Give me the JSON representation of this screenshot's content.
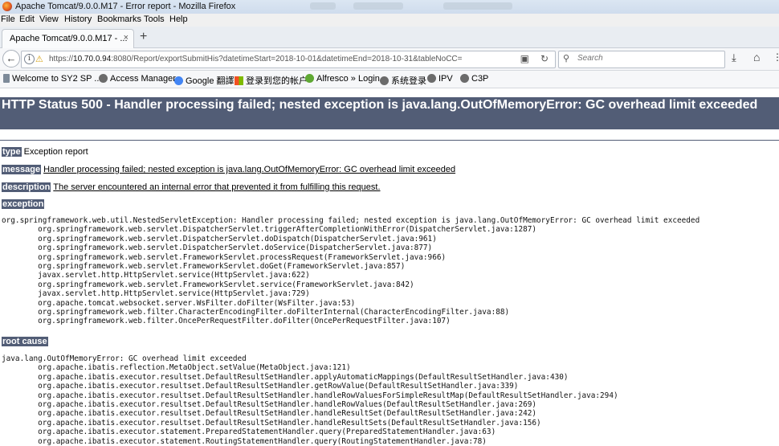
{
  "window": {
    "title": "Apache Tomcat/9.0.0.M17 - Error report - Mozilla Firefox"
  },
  "menu": [
    "File",
    "Edit",
    "View",
    "History",
    "Bookmarks",
    "Tools",
    "Help"
  ],
  "tab": {
    "label": "Apache Tomcat/9.0.0.M17 - ...",
    "close": "×"
  },
  "toolbar": {
    "url_prefix": "https://",
    "url_host": "10.70.0.94",
    "url_rest": ":8080/Report/exportSubmitHis?datetimeStart=2018-10-01&datetimeEnd=2018-10-31&tableNoCC=",
    "search_placeholder": "Search"
  },
  "bookmarks": [
    {
      "label": "Welcome to SY2 SP ...",
      "color": "#7d8a99"
    },
    {
      "label": "Access Manager",
      "color": "#6b6b6b"
    },
    {
      "label": "Google 翻譯",
      "color": "#4285f4"
    },
    {
      "label": "登录到您的帐户",
      "color": "#f25022"
    },
    {
      "label": "Alfresco » Login",
      "color": "#5fa833"
    },
    {
      "label": "系统登录",
      "color": "#6b6b6b"
    },
    {
      "label": "IPV",
      "color": "#6b6b6b"
    },
    {
      "label": "C3P",
      "color": "#6b6b6b"
    }
  ],
  "page": {
    "heading": "HTTP Status 500 - Handler processing failed; nested exception is java.lang.OutOfMemoryError: GC overhead limit exceeded",
    "type_label": "type",
    "type_value": "Exception report",
    "message_label": "message",
    "message_value": "Handler processing failed; nested exception is java.lang.OutOfMemoryError: GC overhead limit exceeded",
    "description_label": "description",
    "description_value": "The server encountered an internal error that prevented it from fulfilling this request.",
    "exception_label": "exception",
    "exception_trace": [
      "org.springframework.web.util.NestedServletException: Handler processing failed; nested exception is java.lang.OutOfMemoryError: GC overhead limit exceeded",
      "\torg.springframework.web.servlet.DispatcherServlet.triggerAfterCompletionWithError(DispatcherServlet.java:1287)",
      "\torg.springframework.web.servlet.DispatcherServlet.doDispatch(DispatcherServlet.java:961)",
      "\torg.springframework.web.servlet.DispatcherServlet.doService(DispatcherServlet.java:877)",
      "\torg.springframework.web.servlet.FrameworkServlet.processRequest(FrameworkServlet.java:966)",
      "\torg.springframework.web.servlet.FrameworkServlet.doGet(FrameworkServlet.java:857)",
      "\tjavax.servlet.http.HttpServlet.service(HttpServlet.java:622)",
      "\torg.springframework.web.servlet.FrameworkServlet.service(FrameworkServlet.java:842)",
      "\tjavax.servlet.http.HttpServlet.service(HttpServlet.java:729)",
      "\torg.apache.tomcat.websocket.server.WsFilter.doFilter(WsFilter.java:53)",
      "\torg.springframework.web.filter.CharacterEncodingFilter.doFilterInternal(CharacterEncodingFilter.java:88)",
      "\torg.springframework.web.filter.OncePerRequestFilter.doFilter(OncePerRequestFilter.java:107)"
    ],
    "root_cause_label": "root cause",
    "root_cause_trace": [
      "java.lang.OutOfMemoryError: GC overhead limit exceeded",
      "\torg.apache.ibatis.reflection.MetaObject.setValue(MetaObject.java:121)",
      "\torg.apache.ibatis.executor.resultset.DefaultResultSetHandler.applyAutomaticMappings(DefaultResultSetHandler.java:430)",
      "\torg.apache.ibatis.executor.resultset.DefaultResultSetHandler.getRowValue(DefaultResultSetHandler.java:339)",
      "\torg.apache.ibatis.executor.resultset.DefaultResultSetHandler.handleRowValuesForSimpleResultMap(DefaultResultSetHandler.java:294)",
      "\torg.apache.ibatis.executor.resultset.DefaultResultSetHandler.handleRowValues(DefaultResultSetHandler.java:269)",
      "\torg.apache.ibatis.executor.resultset.DefaultResultSetHandler.handleResultSet(DefaultResultSetHandler.java:242)",
      "\torg.apache.ibatis.executor.resultset.DefaultResultSetHandler.handleResultSets(DefaultResultSetHandler.java:156)",
      "\torg.apache.ibatis.executor.statement.PreparedStatementHandler.query(PreparedStatementHandler.java:63)",
      "\torg.apache.ibatis.executor.statement.RoutingStatementHandler.query(RoutingStatementHandler.java:78)"
    ]
  },
  "colors": {
    "accent": "#525d76"
  }
}
